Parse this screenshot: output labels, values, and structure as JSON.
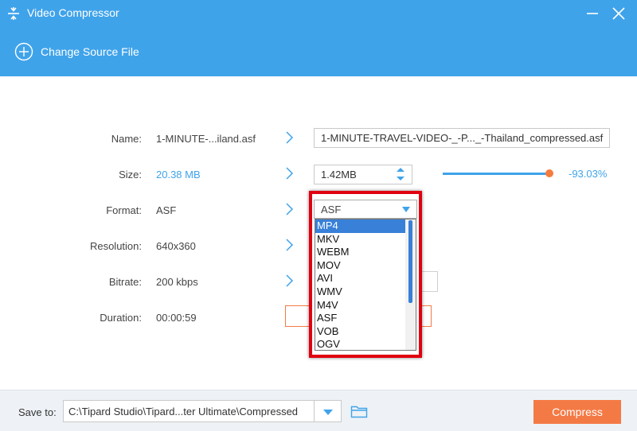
{
  "window": {
    "title": "Video Compressor"
  },
  "toolbar": {
    "change_source_label": "Change Source File"
  },
  "form": {
    "name": {
      "label": "Name:",
      "value": "1-MINUTE-...iland.asf",
      "output": "1-MINUTE-TRAVEL-VIDEO-_-P..._-Thailand_compressed.asf"
    },
    "size": {
      "label": "Size:",
      "value": "20.38 MB",
      "output": "1.42MB",
      "percent": "-93.03%",
      "slider_fraction": 0.96
    },
    "format": {
      "label": "Format:",
      "value": "ASF",
      "selected": "ASF",
      "options": [
        "MP4",
        "MKV",
        "WEBM",
        "MOV",
        "AVI",
        "WMV",
        "M4V",
        "ASF",
        "VOB",
        "OGV"
      ],
      "highlighted_option": "MP4"
    },
    "resolution": {
      "label": "Resolution:",
      "value": "640x360"
    },
    "bitrate": {
      "label": "Bitrate:",
      "value": "200 kbps"
    },
    "duration": {
      "label": "Duration:",
      "value": "00:00:59"
    }
  },
  "footer": {
    "save_to_label": "Save to:",
    "save_path": "C:\\Tipard Studio\\Tipard...ter Ultimate\\Compressed",
    "compress_label": "Compress"
  },
  "colors": {
    "header": "#3fa3ea",
    "accent_orange": "#f47a45",
    "highlight_red": "#e00010",
    "selection_blue": "#3880d8"
  }
}
